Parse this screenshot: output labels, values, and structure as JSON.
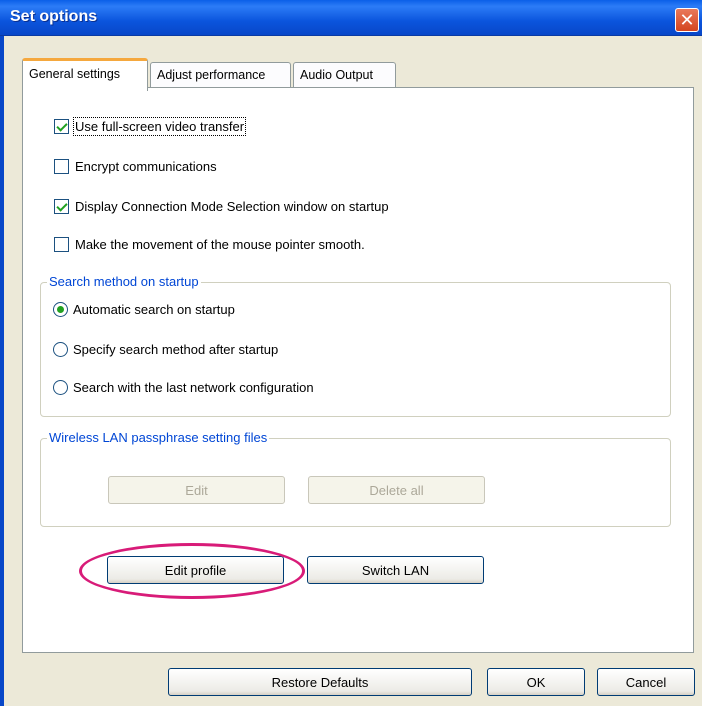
{
  "window": {
    "title": "Set options",
    "close_symbol": "✕"
  },
  "tabs": [
    {
      "label": "General settings",
      "active": true
    },
    {
      "label": "Adjust performance",
      "active": false
    },
    {
      "label": "Audio Output",
      "active": false
    }
  ],
  "checkboxes": [
    {
      "label": "Use full-screen video transfer",
      "checked": true
    },
    {
      "label": "Encrypt communications",
      "checked": false
    },
    {
      "label": "Display Connection Mode Selection window on startup",
      "checked": true
    },
    {
      "label": "Make the movement of the mouse pointer smooth.",
      "checked": false
    }
  ],
  "search_group": {
    "title": "Search method on startup",
    "options": [
      {
        "label": "Automatic search on startup",
        "selected": true
      },
      {
        "label": "Specify search method after startup",
        "selected": false
      },
      {
        "label": "Search with the last network configuration",
        "selected": false
      }
    ]
  },
  "wireless_group": {
    "title": "Wireless LAN passphrase setting files",
    "edit_label": "Edit",
    "delete_all_label": "Delete all"
  },
  "buttons": {
    "edit_profile": "Edit profile",
    "switch_lan": "Switch LAN",
    "restore_defaults": "Restore Defaults",
    "ok": "OK",
    "cancel": "Cancel"
  },
  "colors": {
    "titlebar": "#0a5fe8",
    "active_tab_accent": "#f5a83e",
    "group_title": "#0046d5",
    "check_mark": "#21a121",
    "highlight_oval": "#d81b78"
  }
}
